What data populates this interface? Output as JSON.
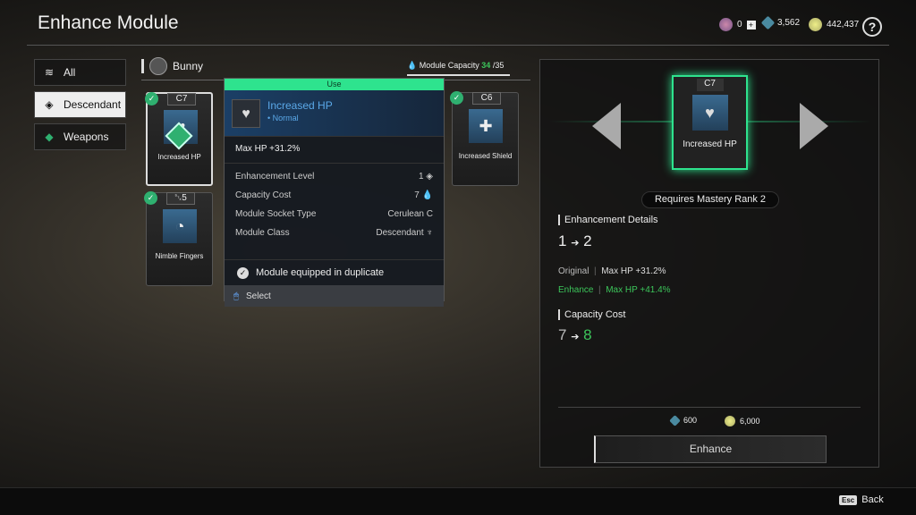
{
  "header": {
    "title": "Enhance Module",
    "currencies": [
      {
        "icon": "mastery-token-icon",
        "value": "0"
      },
      {
        "icon": "kuiper-shard-icon",
        "value": "3,562"
      },
      {
        "icon": "gold-icon",
        "value": "442,437"
      }
    ],
    "help": "?"
  },
  "tabs": [
    {
      "label": "All",
      "icon": "layers-icon",
      "selected": false
    },
    {
      "label": "Descendant",
      "icon": "descendant-icon",
      "selected": true
    },
    {
      "label": "Weapons",
      "icon": "weapon-icon",
      "selected": false
    }
  ],
  "section": {
    "name": "Bunny",
    "capacity_label": "Module Capacity",
    "capacity_used": "34",
    "capacity_max": "/35"
  },
  "modules": [
    {
      "socket": "C7",
      "name": "Increased HP",
      "selected": true
    },
    {
      "socket": "␂5",
      "name": "Nimble Fingers"
    },
    {
      "socket": "C6",
      "name": "Increased Shield"
    }
  ],
  "popup": {
    "use": "Use",
    "name": "Increased HP",
    "tier": "• Normal",
    "effect": "Max HP +31.2%",
    "rows": [
      {
        "label": "Enhancement Level",
        "value": "1"
      },
      {
        "label": "Capacity Cost",
        "value": "7"
      },
      {
        "label": "Module Socket Type",
        "value": "Cerulean"
      },
      {
        "label": "Module Class",
        "value": "Descendant"
      }
    ],
    "duplicate": "Module equipped in duplicate",
    "select": "Select"
  },
  "detail": {
    "module_socket": "C7",
    "module_name": "Increased HP",
    "requirement": "Requires Mastery Rank 2",
    "enh_title": "Enhancement Details",
    "level_from": "1",
    "level_to": "2",
    "original_label": "Original",
    "original_value": "Max HP +31.2%",
    "enhance_label": "Enhance",
    "enhance_value": "Max HP +41.4%",
    "cap_title": "Capacity Cost",
    "cap_from": "7",
    "cap_to": "8",
    "cost_shards": "600",
    "cost_gold": "6,000",
    "button": "Enhance"
  },
  "footer": {
    "key": "Esc",
    "label": "Back"
  },
  "colors": {
    "accent": "#2ee38e",
    "enhance_green": "#3cc55a"
  }
}
